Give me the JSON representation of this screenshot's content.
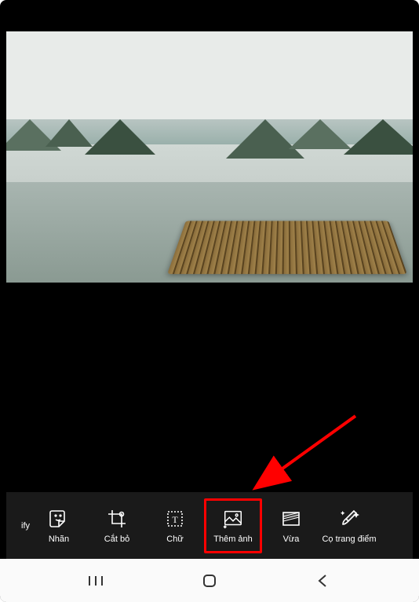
{
  "toolbar": {
    "items": [
      {
        "id": "ify",
        "label": "ify"
      },
      {
        "id": "sticker",
        "label": "Nhãn"
      },
      {
        "id": "crop",
        "label": "Cắt bỏ"
      },
      {
        "id": "text",
        "label": "Chữ"
      },
      {
        "id": "addphoto",
        "label": "Thêm ảnh"
      },
      {
        "id": "fit",
        "label": "Vừa"
      },
      {
        "id": "brush",
        "label": "Cọ trang điểm"
      }
    ]
  },
  "highlighted_tool": "addphoto",
  "nav": {
    "recent": "recent-apps",
    "home": "home",
    "back": "back"
  }
}
